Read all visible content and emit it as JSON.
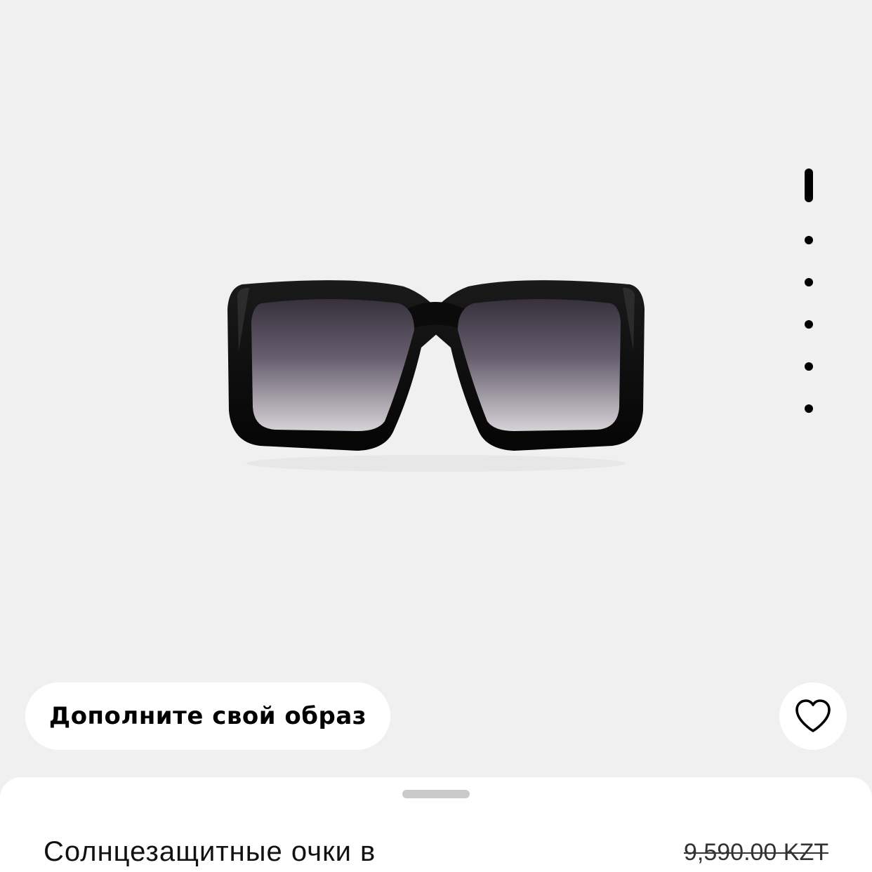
{
  "product": {
    "title": "Солнцезащитные очки в",
    "price_original": "9,590.00 KZT"
  },
  "gallery": {
    "slide_count": 6,
    "active_slide": 1
  },
  "actions": {
    "complete_look_label": "Дополните свой образ"
  },
  "icons": {
    "favorite": "heart-outline-icon"
  },
  "colors": {
    "background": "#f0f0f0",
    "surface": "#ffffff",
    "text": "#000000",
    "handle": "#c9c9c9"
  }
}
